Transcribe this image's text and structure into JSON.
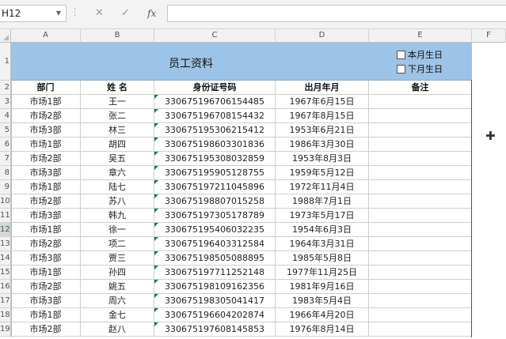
{
  "formula_bar": {
    "name_box": "H12",
    "cancel_icon": "✕",
    "enter_icon": "✓",
    "fx_label": "fx",
    "formula": ""
  },
  "columns": [
    "A",
    "B",
    "C",
    "D",
    "E",
    "F"
  ],
  "rows_visible": [
    "1",
    "2",
    "3",
    "4",
    "5",
    "6",
    "7",
    "8",
    "9",
    "10",
    "11",
    "12",
    "13",
    "14",
    "15",
    "16",
    "17",
    "18",
    "19"
  ],
  "selected_row": "12",
  "sheet": {
    "title": "员工资料",
    "checkbox_this_month": "本月生日",
    "checkbox_next_month": "下月生日",
    "headers": [
      "部门",
      "姓  名",
      "身份证号码",
      "出月年月",
      "备注"
    ],
    "rows": [
      [
        "市场1部",
        "王一",
        "330675196706154485",
        "1967年6月15日",
        ""
      ],
      [
        "市场2部",
        "张二",
        "330675196708154432",
        "1967年8月15日",
        ""
      ],
      [
        "市场3部",
        "林三",
        "330675195306215412",
        "1953年6月21日",
        ""
      ],
      [
        "市场1部",
        "胡四",
        "330675198603301836",
        "1986年3月30日",
        ""
      ],
      [
        "市场2部",
        "吴五",
        "330675195308032859",
        "1953年8月3日",
        ""
      ],
      [
        "市场3部",
        "章六",
        "330675195905128755",
        "1959年5月12日",
        ""
      ],
      [
        "市场1部",
        "陆七",
        "330675197211045896",
        "1972年11月4日",
        ""
      ],
      [
        "市场2部",
        "苏八",
        "330675198807015258",
        "1988年7月1日",
        ""
      ],
      [
        "市场3部",
        "韩九",
        "330675197305178789",
        "1973年5月17日",
        ""
      ],
      [
        "市场1部",
        "徐一",
        "330675195406032235",
        "1954年6月3日",
        ""
      ],
      [
        "市场2部",
        "项二",
        "330675196403312584",
        "1964年3月31日",
        ""
      ],
      [
        "市场3部",
        "贾三",
        "330675198505088895",
        "1985年5月8日",
        ""
      ],
      [
        "市场1部",
        "孙四",
        "330675197711252148",
        "1977年11月25日",
        ""
      ],
      [
        "市场2部",
        "姚五",
        "330675198109162356",
        "1981年9月16日",
        ""
      ],
      [
        "市场3部",
        "周六",
        "330675198305041417",
        "1983年5月4日",
        ""
      ],
      [
        "市场1部",
        "金七",
        "330675196604202874",
        "1966年4月20日",
        ""
      ],
      [
        "市场2部",
        "赵八",
        "330675197608145853",
        "1976年8月14日",
        ""
      ]
    ]
  }
}
